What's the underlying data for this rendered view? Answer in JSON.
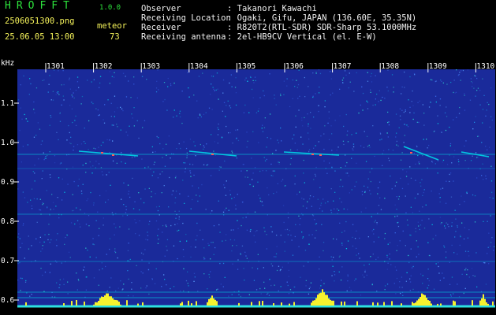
{
  "header": {
    "logo": "HROFFT",
    "version": "1.0.0",
    "filename": "2506051300.png",
    "datetime": "25.06.05 13:00",
    "meteor_label": "meteor",
    "meteor_count": "73",
    "info": [
      {
        "label": "Observer",
        "value": ": Takanori Kawachi"
      },
      {
        "label": "Receiving Location",
        "value": ": Ogaki, Gifu, JAPAN (136.60E, 35.35N)"
      },
      {
        "label": "Receiver",
        "value": ": R820T2(RTL-SDR) SDR-Sharp 53.1000MHz"
      },
      {
        "label": "Receiving antenna",
        "value": ": 2el-HB9CV Vertical (el. E-W)"
      }
    ]
  },
  "spectrogram": {
    "y_unit": "kHz",
    "y_ticks": [
      "1.1",
      "1.0",
      "0.9",
      "0.8",
      "0.7",
      "0.6"
    ],
    "x_ticks": [
      "1301",
      "1302",
      "1303",
      "1304",
      "1305",
      "1306",
      "1307",
      "1308",
      "1309",
      "1310"
    ],
    "colors": {
      "background": "#1a2a9a",
      "noise": "#00d8e8",
      "signal": "#ff5555",
      "activity": "#f6f22e",
      "baseline": "#2de0e0"
    }
  }
}
